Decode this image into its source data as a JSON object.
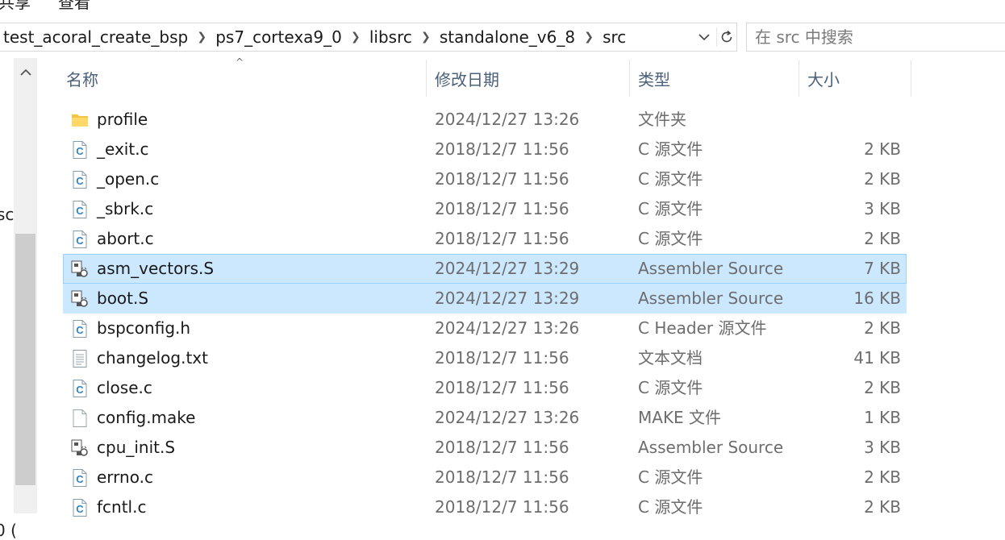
{
  "menu": {
    "item1": "共享",
    "item2": "查看"
  },
  "address": {
    "crumbs": [
      "test_acoral_create_bsp",
      "ps7_cortexa9_0",
      "libsrc",
      "standalone_v6_8",
      "src"
    ]
  },
  "search": {
    "placeholder": "在 src 中搜索"
  },
  "nav": {
    "clip1": "sc",
    "clip2": "0 ("
  },
  "columns": {
    "name": "名称",
    "date": "修改日期",
    "type": "类型",
    "size": "大小"
  },
  "files": [
    {
      "name": "profile",
      "date": "2024/12/27 13:26",
      "type": "文件夹",
      "size": "",
      "icon": "folder-icon",
      "selected": false
    },
    {
      "name": "_exit.c",
      "date": "2018/12/7 11:56",
      "type": "C 源文件",
      "size": "2 KB",
      "icon": "c-file-icon",
      "selected": false
    },
    {
      "name": "_open.c",
      "date": "2018/12/7 11:56",
      "type": "C 源文件",
      "size": "2 KB",
      "icon": "c-file-icon",
      "selected": false
    },
    {
      "name": "_sbrk.c",
      "date": "2018/12/7 11:56",
      "type": "C 源文件",
      "size": "3 KB",
      "icon": "c-file-icon",
      "selected": false
    },
    {
      "name": "abort.c",
      "date": "2018/12/7 11:56",
      "type": "C 源文件",
      "size": "2 KB",
      "icon": "c-file-icon",
      "selected": false
    },
    {
      "name": "asm_vectors.S",
      "date": "2024/12/27 13:29",
      "type": "Assembler Source",
      "size": "7 KB",
      "icon": "assembler-file-icon",
      "selected": true
    },
    {
      "name": "boot.S",
      "date": "2024/12/27 13:29",
      "type": "Assembler Source",
      "size": "16 KB",
      "icon": "assembler-file-icon",
      "selected": true
    },
    {
      "name": "bspconfig.h",
      "date": "2024/12/27 13:26",
      "type": "C Header 源文件",
      "size": "2 KB",
      "icon": "c-file-icon",
      "selected": false
    },
    {
      "name": "changelog.txt",
      "date": "2018/12/7 11:56",
      "type": "文本文档",
      "size": "41 KB",
      "icon": "text-file-icon",
      "selected": false
    },
    {
      "name": "close.c",
      "date": "2018/12/7 11:56",
      "type": "C 源文件",
      "size": "2 KB",
      "icon": "c-file-icon",
      "selected": false
    },
    {
      "name": "config.make",
      "date": "2024/12/27 13:26",
      "type": "MAKE 文件",
      "size": "1 KB",
      "icon": "blank-file-icon",
      "selected": false
    },
    {
      "name": "cpu_init.S",
      "date": "2018/12/7 11:56",
      "type": "Assembler Source",
      "size": "3 KB",
      "icon": "assembler-file-icon",
      "selected": false
    },
    {
      "name": "errno.c",
      "date": "2018/12/7 11:56",
      "type": "C 源文件",
      "size": "2 KB",
      "icon": "c-file-icon",
      "selected": false
    },
    {
      "name": "fcntl.c",
      "date": "2018/12/7 11:56",
      "type": "C 源文件",
      "size": "2 KB",
      "icon": "c-file-icon",
      "selected": false
    }
  ]
}
